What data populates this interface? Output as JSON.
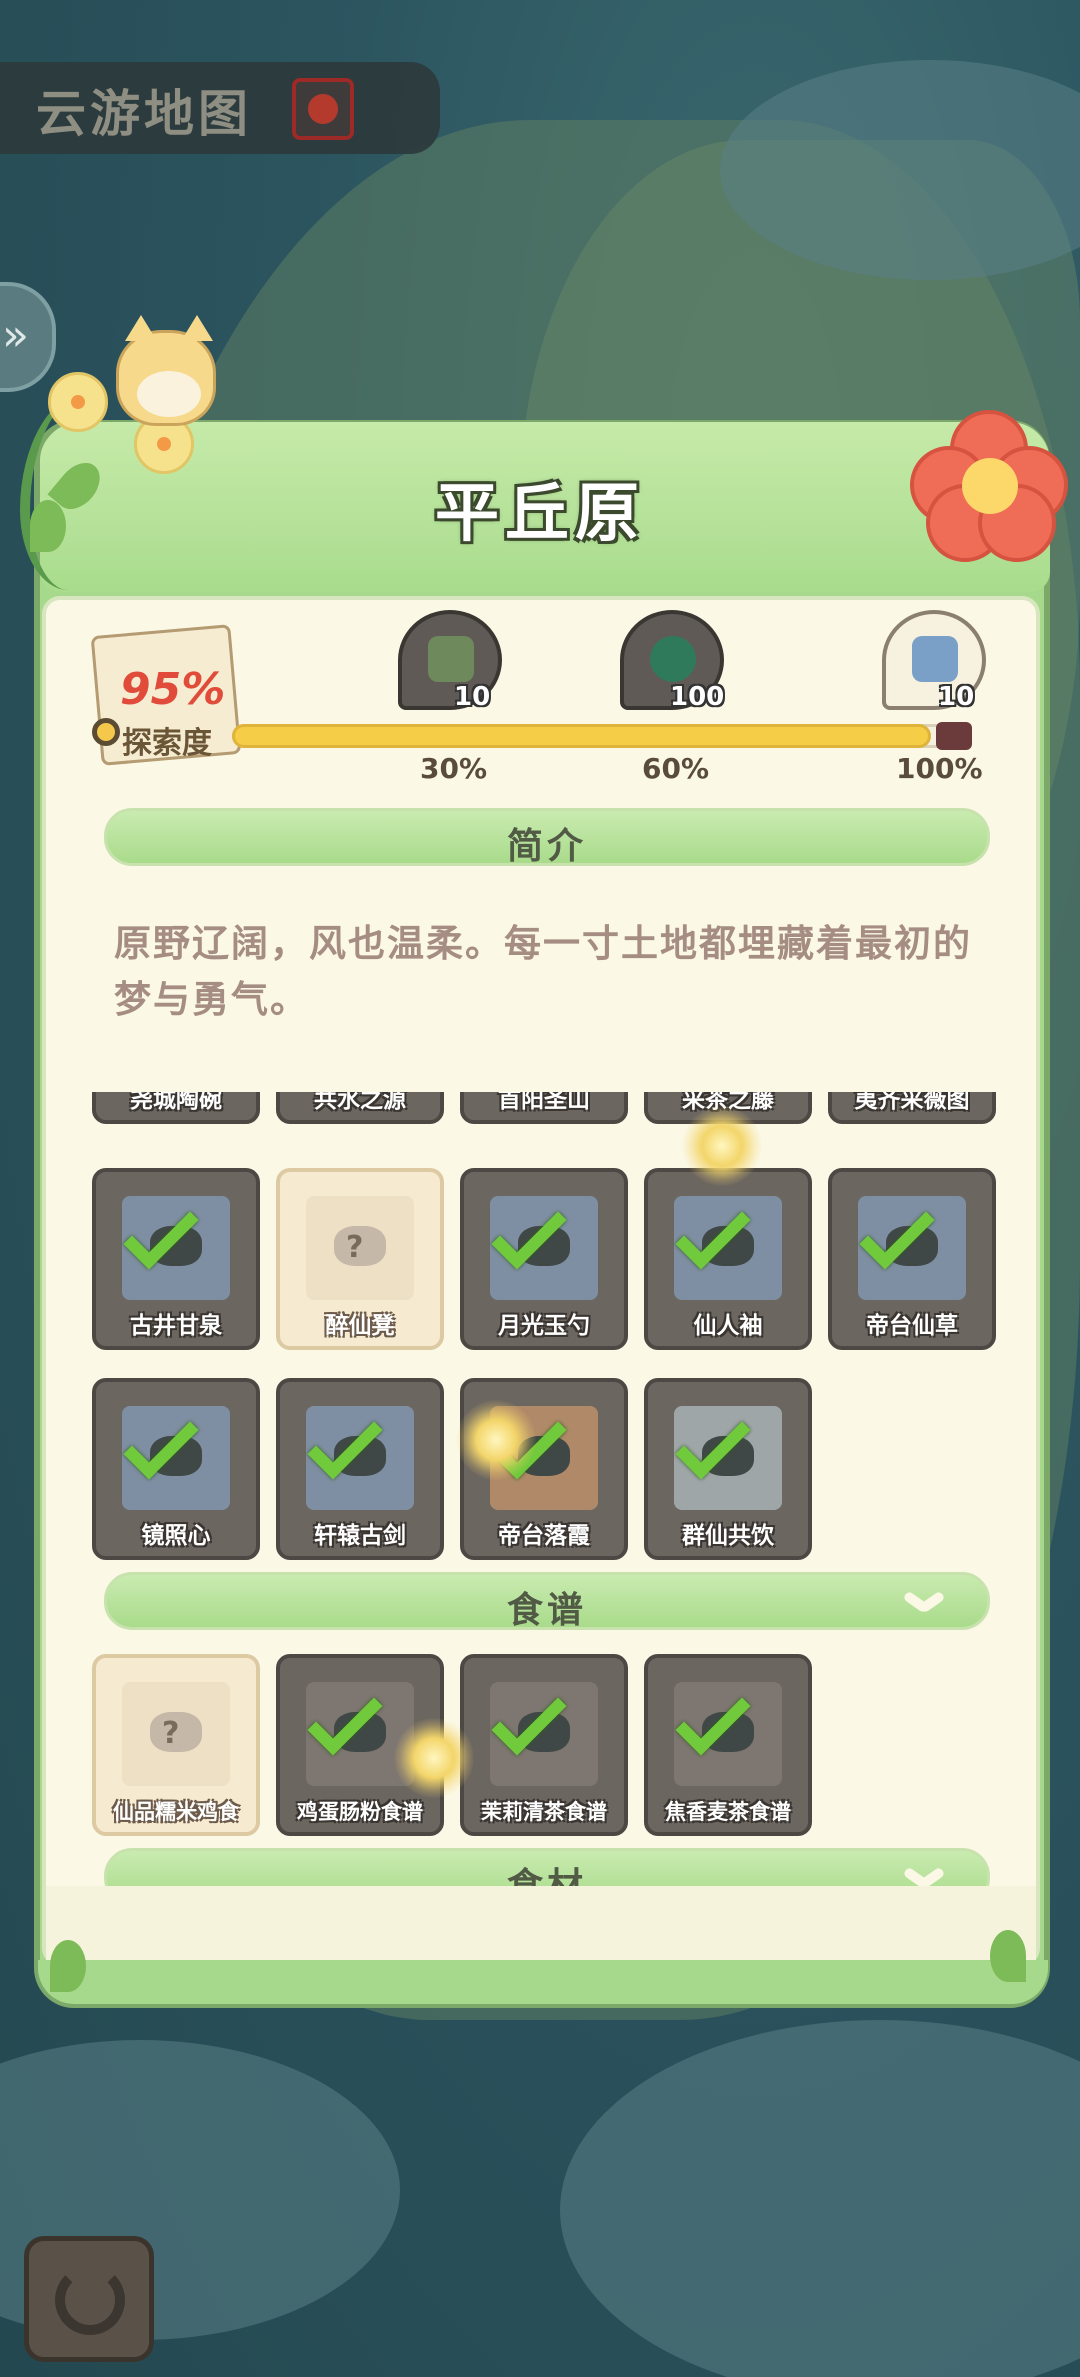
{
  "map": {
    "title": "云游地图"
  },
  "panel": {
    "title": "平丘原"
  },
  "exploration": {
    "percent_label": "95%",
    "label": "探索度",
    "progress": 0.95,
    "milestones": [
      {
        "percent": "30%",
        "reward_count": "10",
        "reward_icon": "supply-crate-icon"
      },
      {
        "percent": "60%",
        "reward_count": "100",
        "reward_icon": "jade-coin-icon"
      },
      {
        "percent": "100%",
        "reward_count": "10",
        "reward_icon": "scroll-gift-icon"
      }
    ]
  },
  "intro": {
    "header": "简介",
    "text": "原野辽阔，风也温柔。每一寸土地都埋藏着最初的梦与勇气。"
  },
  "collections": {
    "partial_row": [
      "尧城陶碗",
      "共水之源",
      "首阳圣山",
      "采茶之藤",
      "夷齐采薇图"
    ],
    "row2": [
      {
        "label": "古井甘泉",
        "collected": true
      },
      {
        "label": "醉仙凳",
        "collected": false
      },
      {
        "label": "月光玉勺",
        "collected": true
      },
      {
        "label": "仙人袖",
        "collected": true
      },
      {
        "label": "帝台仙草",
        "collected": true
      }
    ],
    "row3": [
      {
        "label": "镜照心",
        "collected": true
      },
      {
        "label": "轩辕古剑",
        "collected": true
      },
      {
        "label": "帝台落霞",
        "collected": true
      },
      {
        "label": "群仙共饮",
        "collected": true
      }
    ]
  },
  "recipes": {
    "header": "食谱",
    "items": [
      {
        "label": "仙品糯米鸡食",
        "collected": false
      },
      {
        "label": "鸡蛋肠粉食谱",
        "collected": true
      },
      {
        "label": "茉莉清茶食谱",
        "collected": true
      },
      {
        "label": "焦香麦茶食谱",
        "collected": true
      }
    ]
  },
  "ingredients": {
    "header": "食材"
  },
  "colors": {
    "panel_green": "#a6d98b",
    "paper": "#fbf8e6",
    "check_green": "#71c93c",
    "accent_red": "#e14b3a",
    "progress_yellow": "#f5cd47"
  }
}
